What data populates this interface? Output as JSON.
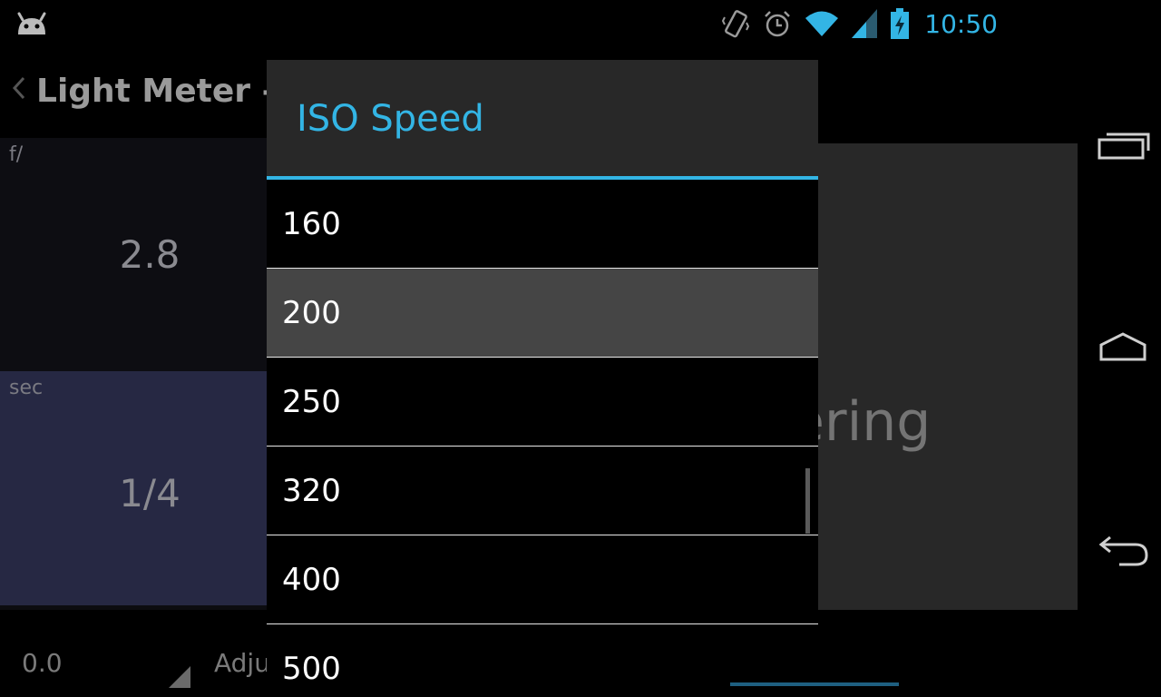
{
  "status_bar": {
    "time": "10:50",
    "accent_color": "#33b5e5",
    "icons": [
      "android-icon",
      "vibrate-icon",
      "alarm-icon",
      "wifi-icon",
      "signal-icon",
      "battery-charging-icon"
    ]
  },
  "app": {
    "title": "Light Meter - S"
  },
  "meter": {
    "aperture": {
      "label": "f/",
      "value": "2.8"
    },
    "shutter": {
      "label": "sec",
      "value": "1/4"
    },
    "compensation": {
      "value": "0.0"
    },
    "adjust_label": "Adju",
    "metering_label": "ering"
  },
  "dialog": {
    "title": "ISO Speed",
    "items": [
      "160",
      "200",
      "250",
      "320",
      "400",
      "500"
    ],
    "selected_value": "200"
  },
  "nav_bar": {
    "buttons": [
      "recents-icon",
      "home-icon",
      "back-icon"
    ]
  }
}
